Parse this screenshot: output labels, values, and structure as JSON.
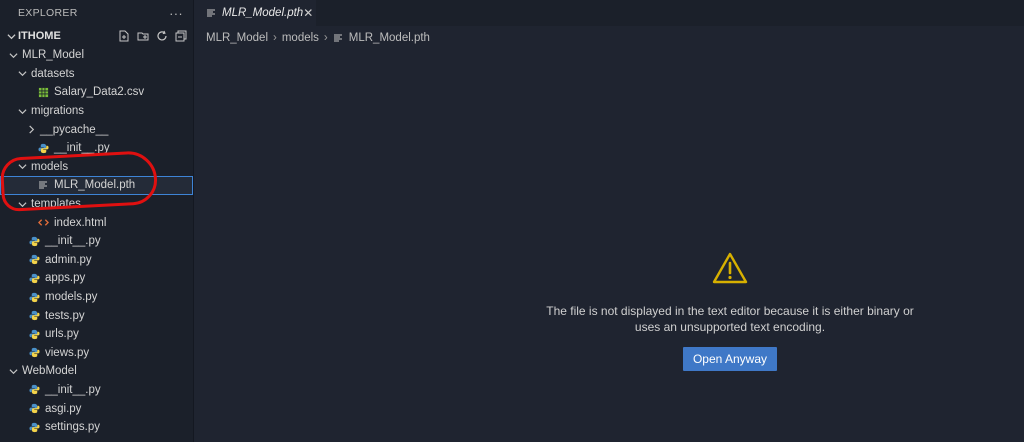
{
  "sidebar": {
    "header": "EXPLORER",
    "more": "···",
    "workspace": "ITHOME",
    "tree": [
      {
        "label": "MLR_Model",
        "indent": 1,
        "type": "folder",
        "open": true
      },
      {
        "label": "datasets",
        "indent": 2,
        "type": "folder",
        "open": true
      },
      {
        "label": "Salary_Data2.csv",
        "indent": 3,
        "type": "csv"
      },
      {
        "label": "migrations",
        "indent": 2,
        "type": "folder",
        "open": true
      },
      {
        "label": "__pycache__",
        "indent": 3,
        "type": "folder",
        "open": false
      },
      {
        "label": "__init__.py",
        "indent": 3,
        "type": "py"
      },
      {
        "label": "models",
        "indent": 2,
        "type": "folder",
        "open": true
      },
      {
        "label": "MLR_Model.pth",
        "indent": 3,
        "type": "file",
        "selected": true
      },
      {
        "label": "templates",
        "indent": 2,
        "type": "folder",
        "open": true
      },
      {
        "label": "index.html",
        "indent": 3,
        "type": "html"
      },
      {
        "label": "__init__.py",
        "indent": 2,
        "type": "py"
      },
      {
        "label": "admin.py",
        "indent": 2,
        "type": "py"
      },
      {
        "label": "apps.py",
        "indent": 2,
        "type": "py"
      },
      {
        "label": "models.py",
        "indent": 2,
        "type": "py"
      },
      {
        "label": "tests.py",
        "indent": 2,
        "type": "py"
      },
      {
        "label": "urls.py",
        "indent": 2,
        "type": "py"
      },
      {
        "label": "views.py",
        "indent": 2,
        "type": "py"
      },
      {
        "label": "WebModel",
        "indent": 1,
        "type": "folder",
        "open": true
      },
      {
        "label": "__init__.py",
        "indent": 2,
        "type": "py"
      },
      {
        "label": "asgi.py",
        "indent": 2,
        "type": "py"
      },
      {
        "label": "settings.py",
        "indent": 2,
        "type": "py"
      }
    ]
  },
  "tab": {
    "label": "MLR_Model.pth",
    "close": "✕"
  },
  "breadcrumb": [
    "MLR_Model",
    "models",
    "MLR_Model.pth"
  ],
  "editor": {
    "message_line1": "The file is not displayed in the text editor because it is either binary or",
    "message_line2": "uses an unsupported text encoding.",
    "button": "Open Anyway"
  },
  "colors": {
    "accent": "#3f78c7",
    "warning": "#d7b000",
    "python": "#4a90c8",
    "csv": "#7bbf3a",
    "html": "#e06c3a",
    "annotation": "#e01010"
  }
}
